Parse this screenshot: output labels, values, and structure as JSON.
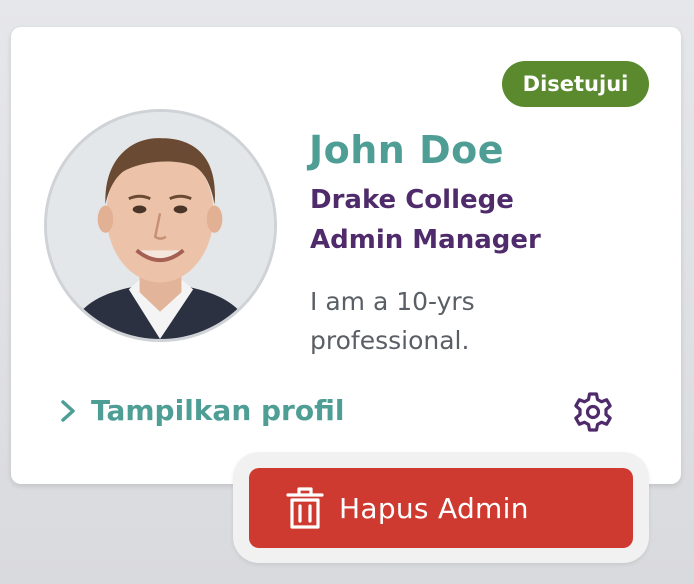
{
  "card": {
    "status": "Disetujui",
    "name": "John Doe",
    "organization": "Drake College",
    "role": "Admin Manager",
    "bio": "I am a 10-yrs professional.",
    "view_profile_label": "Tampilkan profil",
    "delete_label": "Hapus Admin",
    "icons": {
      "view_profile": "chevron-right-icon",
      "settings": "gear-icon",
      "delete": "trash-icon"
    }
  },
  "colors": {
    "status_badge": "#5b8a2e",
    "name": "#4e9e95",
    "org_role": "#4f2b6b",
    "link": "#4e9e95",
    "delete_button": "#cf3a30",
    "settings_icon": "#4f2b6b"
  }
}
